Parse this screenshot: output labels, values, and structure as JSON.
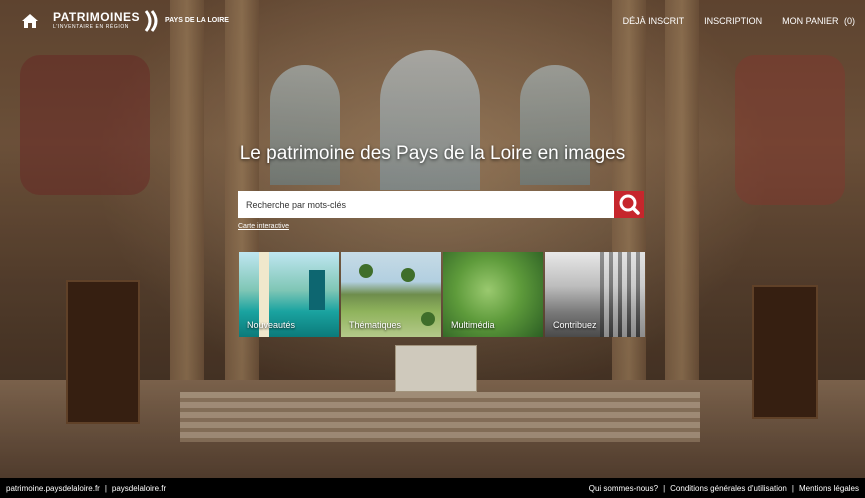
{
  "header": {
    "logo_primary": "PATRIMOINES",
    "logo_secondary": "L'INVENTAIRE EN RÉGION",
    "region_logo": "PAYS DE LA LOIRE",
    "nav": {
      "deja_inscrit": "DÉJÀ INSCRIT",
      "inscription": "INSCRIPTION",
      "panier": "MON PANIER",
      "panier_count": "(0)"
    }
  },
  "hero": {
    "title": "Le patrimoine des Pays de la Loire en images",
    "search_placeholder": "Recherche par mots-clés",
    "carte_link": "Carte interactive"
  },
  "tiles": [
    {
      "label": "Nouveautés"
    },
    {
      "label": "Thématiques"
    },
    {
      "label": "Multimédia"
    },
    {
      "label": "Contribuez"
    }
  ],
  "footer": {
    "left_links": [
      "patrimoine.paysdelaloire.fr",
      "paysdelaloire.fr"
    ],
    "right_links": [
      "Qui sommes-nous?",
      "Conditions générales d'utilisation",
      "Mentions légales"
    ],
    "separator": "|"
  },
  "colors": {
    "search_button": "#c6262c",
    "footer_bg": "#000000"
  },
  "icons": {
    "home": "home-icon",
    "search": "search-icon"
  }
}
